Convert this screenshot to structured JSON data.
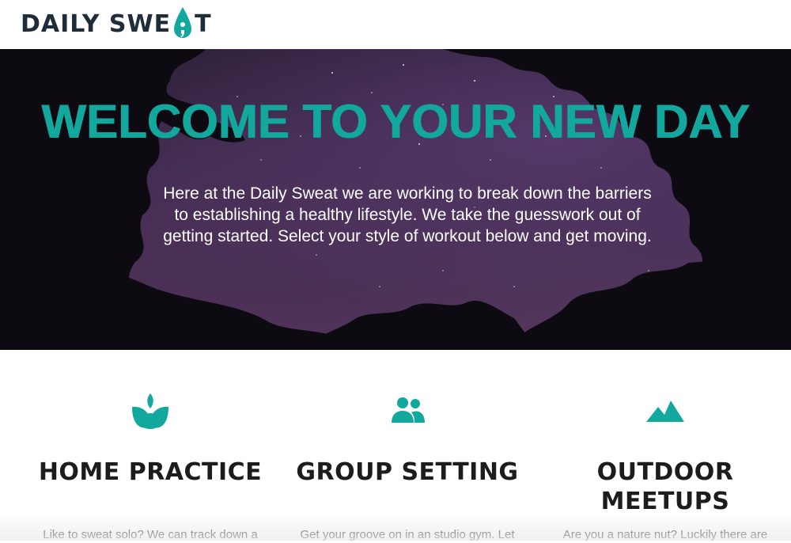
{
  "brand": {
    "logo_part1": "DAILY SWE",
    "logo_part2": "T",
    "dark_color": "#1f2d3a",
    "accent_color": "#13a89e"
  },
  "hero": {
    "title": "WELCOME TO YOUR NEW DAY",
    "text": "Here at the Daily Sweat we are working to break down the barriers to establishing a healthy lifestyle. We take the guesswork out of getting started. Select your style of workout below and get moving."
  },
  "features": [
    {
      "icon": "sprout-icon",
      "title": "HOME PRACTICE",
      "text": "Like to sweat solo? We can track down a"
    },
    {
      "icon": "people-icon",
      "title": "GROUP SETTING",
      "text": "Get your groove on in an studio gym. Let"
    },
    {
      "icon": "mountain-icon",
      "title": "OUTDOOR MEETUPS",
      "text": "Are you a nature nut? Luckily there are"
    }
  ]
}
